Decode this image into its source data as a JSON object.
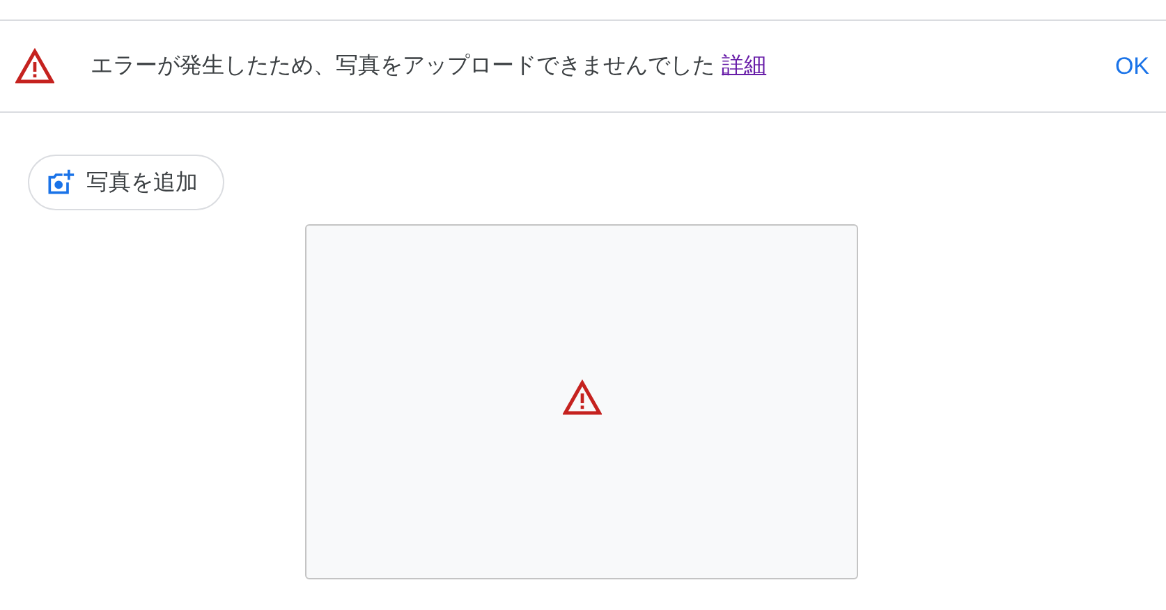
{
  "banner": {
    "message": "エラーが発生したため、写真をアップロードできませんでした",
    "link": "詳細",
    "action": "OK"
  },
  "add_photo_button": {
    "label": "写真を追加"
  },
  "photo_slot": {
    "error": true
  }
}
